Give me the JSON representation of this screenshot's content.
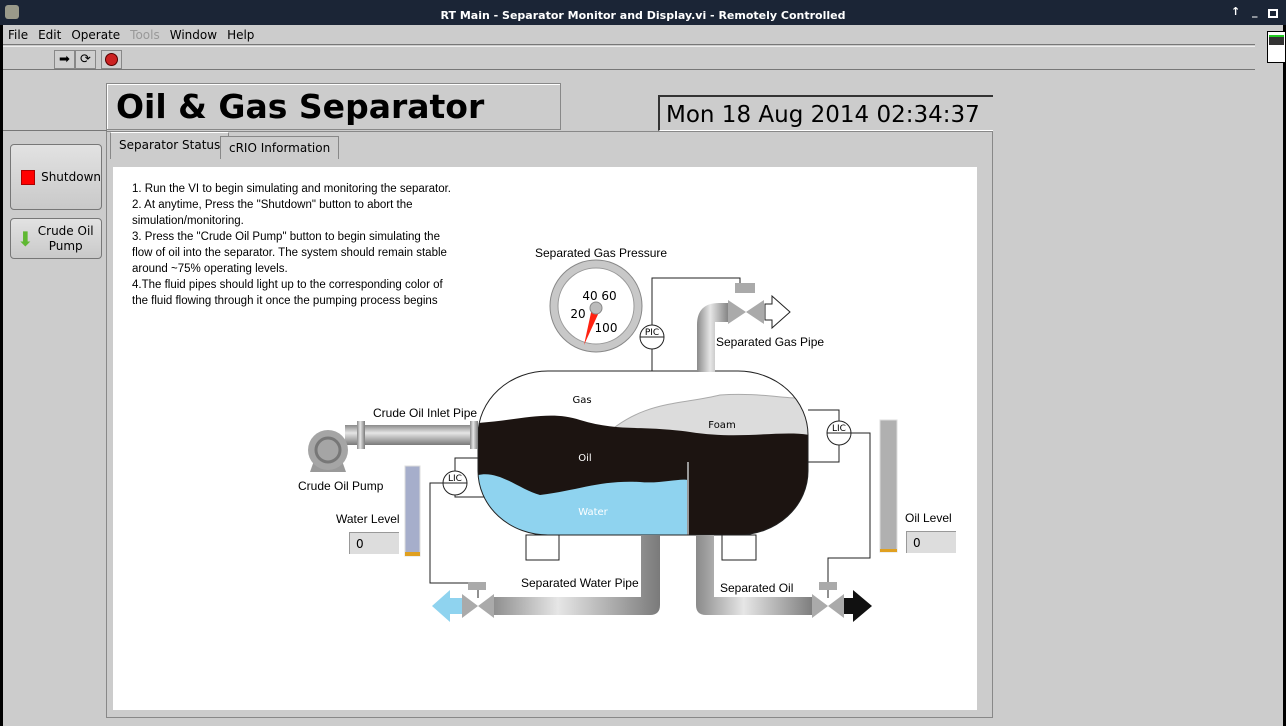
{
  "window": {
    "title": "RT Main - Separator Monitor and Display.vi - Remotely Controlled"
  },
  "menu": [
    "File",
    "Edit",
    "Operate",
    "Tools",
    "Window",
    "Help"
  ],
  "menu_disabled": [
    "Tools"
  ],
  "toolbar": {
    "run": "run-arrow-icon",
    "run_continuously": "run-continuously-icon",
    "abort": "abort-icon"
  },
  "header": {
    "title": "Oil & Gas Separator",
    "datetime": "Mon 18 Aug 2014 02:34:37"
  },
  "buttons": {
    "shutdown": "Shutdown",
    "pump_line1": "Crude Oil",
    "pump_line2": "Pump"
  },
  "tabs": [
    {
      "label": "Separator Status",
      "selected": true
    },
    {
      "label": "cRIO Information",
      "selected": false
    }
  ],
  "instructions": [
    "1. Run the VI to begin simulating and monitoring the separator.",
    "2. At anytime, Press the \"Shutdown\" button to abort the simulation/monitoring.",
    "3. Press the \"Crude Oil Pump\" button to begin simulating the flow of oil into the separator. The system should remain stable around ~75% operating levels.",
    "4.The fluid pipes should light up to the corresponding color of the fluid flowing through it once the pumping process begins"
  ],
  "gauge": {
    "label": "Separated Gas Pressure",
    "ticks": [
      "20",
      "40",
      "60",
      "100"
    ],
    "min": 0,
    "max": 100,
    "value": 0
  },
  "diagram": {
    "gas": "Gas",
    "foam": "Foam",
    "oil": "Oil",
    "water": "Water",
    "inlet_pipe": "Crude Oil Inlet Pipe",
    "pump": "Crude Oil Pump",
    "gas_pipe": "Separated Gas Pipe",
    "water_pipe": "Separated Water Pipe",
    "oil_pipe": "Separated Oil",
    "pic": "PIC",
    "lic": "LIC"
  },
  "water_level": {
    "label": "Water Level",
    "value": "0",
    "fraction": 0
  },
  "oil_level": {
    "label": "Oil Level",
    "value": "0",
    "fraction": 0
  },
  "colors": {
    "water": "#8fd3ef",
    "oil": "#1c1411",
    "foam": "#d8d8d8",
    "shutdown": "#ff0000",
    "pump_icon": "#6cbf3a"
  }
}
